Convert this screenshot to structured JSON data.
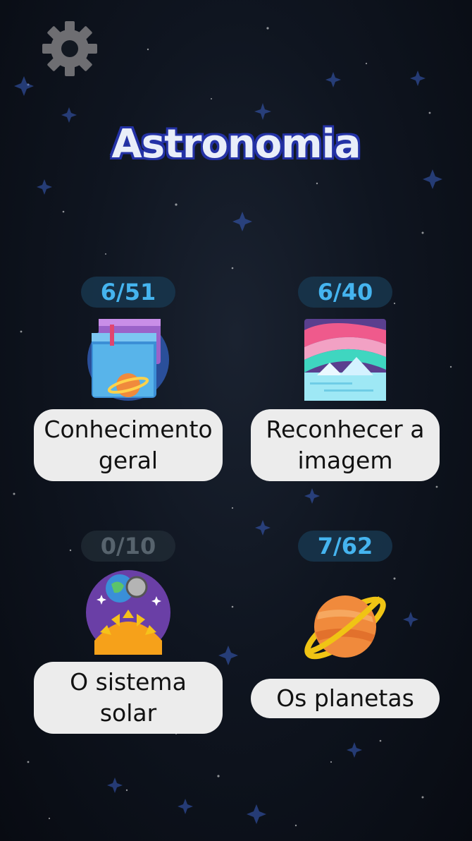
{
  "title": "Astronomia",
  "settings_icon": "gear-icon",
  "categories": [
    {
      "progress": "6/51",
      "label": "Conhecimento geral",
      "icon": "books-planet-icon",
      "locked": false
    },
    {
      "progress": "6/40",
      "label": "Reconhecer a imagem",
      "icon": "aurora-landscape-icon",
      "locked": false
    },
    {
      "progress": "0/10",
      "label": "O sistema solar",
      "icon": "solar-system-icon",
      "locked": true
    },
    {
      "progress": "7/62",
      "label": "Os planetas",
      "icon": "ringed-planet-icon",
      "locked": false
    }
  ]
}
